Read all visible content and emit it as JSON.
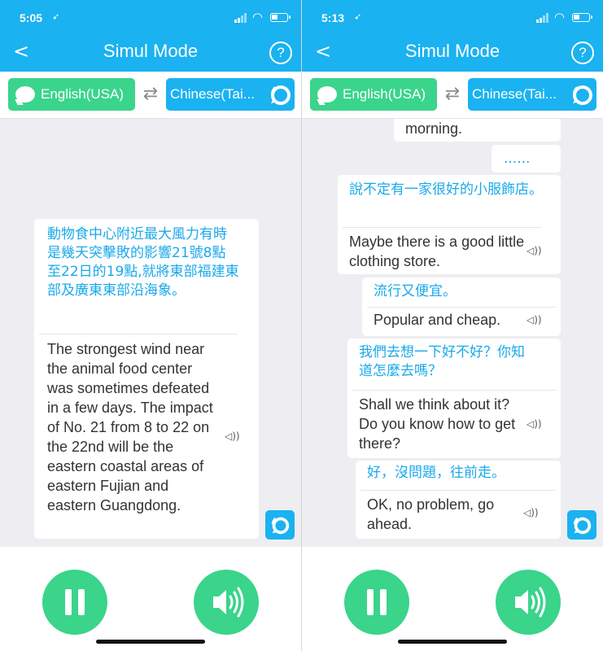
{
  "left": {
    "status": {
      "time": "5:05",
      "loc": "➶"
    },
    "header": {
      "back": "<",
      "title": "Simul Mode",
      "help": "?"
    },
    "langs": {
      "source": "English(USA)",
      "swap": "⇄",
      "target": "Chinese(Tai..."
    },
    "messages": [
      {
        "zh": "動物食中心附近最大風力有時是幾天突擊敗的影響21號8點至22日的19點,就將東部福建東部及廣東東部沿海象。",
        "en": "The strongest wind near the animal food center was sometimes defeated in a few days. The impact of No. 21 from 8 to 22 on the 22nd will be the eastern coastal areas of eastern Fujian and eastern Guangdong."
      }
    ]
  },
  "right": {
    "status": {
      "time": "5:13",
      "loc": "➶"
    },
    "header": {
      "back": "<",
      "title": "Simul Mode",
      "help": "?"
    },
    "langs": {
      "source": "English(USA)",
      "swap": "⇄",
      "target": "Chinese(Tai..."
    },
    "partial_top": {
      "en": "morning."
    },
    "pending": {
      "text": "......"
    },
    "messages": [
      {
        "zh": "說不定有一家很好的小服飾店。",
        "en": "Maybe there is a good little clothing store."
      },
      {
        "zh": "流行又便宜。",
        "en": "Popular and cheap."
      },
      {
        "zh": "我們去想一下好不好？你知道怎麼去嗎？",
        "en": "Shall we think about it? Do you know how to get there?"
      },
      {
        "zh": "好，沒問題，往前走。",
        "en": "OK, no problem, go ahead."
      }
    ]
  },
  "colors": {
    "accent_blue": "#1ab2f0",
    "accent_green": "#3ad48b",
    "chat_bg": "#eeeef2",
    "zh_text": "#1aa9ea"
  }
}
